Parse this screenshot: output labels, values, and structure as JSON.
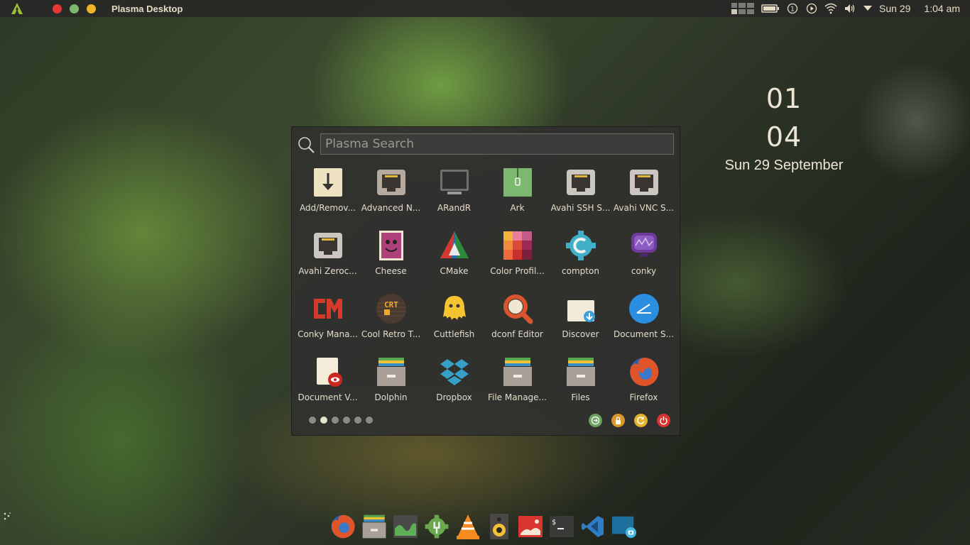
{
  "top_panel": {
    "window_title": "Plasma Desktop",
    "date_short": "Sun 29",
    "time": "1:04 am",
    "colors": {
      "close": "#e53935",
      "maximize": "#7cb870",
      "minimize": "#f0b429"
    }
  },
  "desktop_clock": {
    "hours": "01",
    "minutes": "04",
    "date": "Sun 29 September"
  },
  "launcher": {
    "search_placeholder": "Plasma Search",
    "apps": [
      {
        "label": "Add/Remov...",
        "icon": "download-box-icon"
      },
      {
        "label": "Advanced N...",
        "icon": "network-port-icon"
      },
      {
        "label": "ARandR",
        "icon": "monitor-icon"
      },
      {
        "label": "Ark",
        "icon": "archive-icon"
      },
      {
        "label": "Avahi SSH S...",
        "icon": "network-port-icon"
      },
      {
        "label": "Avahi VNC S...",
        "icon": "network-port-icon"
      },
      {
        "label": "Avahi Zeroc...",
        "icon": "network-port-icon"
      },
      {
        "label": "Cheese",
        "icon": "cheese-face-icon"
      },
      {
        "label": "CMake",
        "icon": "cmake-triangle-icon"
      },
      {
        "label": "Color Profil...",
        "icon": "color-grid-icon"
      },
      {
        "label": "compton",
        "icon": "gear-c-icon"
      },
      {
        "label": "conky",
        "icon": "conky-monitor-icon"
      },
      {
        "label": "Conky Mana...",
        "icon": "cm-logo-icon"
      },
      {
        "label": "Cool Retro T...",
        "icon": "crt-icon"
      },
      {
        "label": "Cuttlefish",
        "icon": "cuttlefish-icon"
      },
      {
        "label": "dconf Editor",
        "icon": "magnifier-icon"
      },
      {
        "label": "Discover",
        "icon": "shopping-bag-icon"
      },
      {
        "label": "Document S...",
        "icon": "document-scanner-icon"
      },
      {
        "label": "Document V...",
        "icon": "document-viewer-icon"
      },
      {
        "label": "Dolphin",
        "icon": "file-cabinet-icon"
      },
      {
        "label": "Dropbox",
        "icon": "dropbox-icon"
      },
      {
        "label": "File Manage...",
        "icon": "file-cabinet-icon"
      },
      {
        "label": "Files",
        "icon": "file-cabinet-icon"
      },
      {
        "label": "Firefox",
        "icon": "firefox-icon"
      }
    ],
    "pages": 6,
    "active_page": 2,
    "actions": [
      {
        "name": "logout-icon",
        "color": "#6fa15f"
      },
      {
        "name": "lock-icon",
        "color": "#d9972b"
      },
      {
        "name": "restart-icon",
        "color": "#e2b32f"
      },
      {
        "name": "shutdown-icon",
        "color": "#d8352e"
      }
    ]
  },
  "dock": {
    "items": [
      "firefox-icon",
      "file-cabinet-icon",
      "system-monitor-icon",
      "settings-gear-icon",
      "vlc-cone-icon",
      "speaker-icon",
      "image-viewer-icon",
      "terminal-icon",
      "vscode-icon",
      "screenshot-icon"
    ]
  }
}
